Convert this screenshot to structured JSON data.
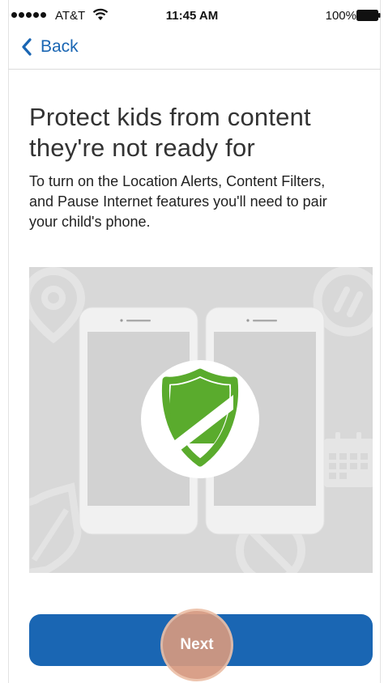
{
  "status_bar": {
    "carrier": "AT&T",
    "time": "11:45 AM",
    "battery": "100%"
  },
  "nav": {
    "back_label": "Back"
  },
  "content": {
    "title": "Protect kids from content they're not ready for",
    "body": "To turn on the Location Alerts, Content Filters, and Pause Internet features you'll need to pair your child's phone."
  },
  "illustration": {
    "icons": [
      "location-pin-icon",
      "pause-icon",
      "calendar-icon",
      "shield-icon",
      "block-icon",
      "phone-icon"
    ],
    "colors": {
      "background": "#d8d8d8",
      "shield_green": "#5aab2d",
      "phone": "#f1f1f1"
    }
  },
  "actions": {
    "next_label": "Next"
  },
  "colors": {
    "accent": "#1a66b3",
    "tap_highlight": "#d6997f"
  }
}
